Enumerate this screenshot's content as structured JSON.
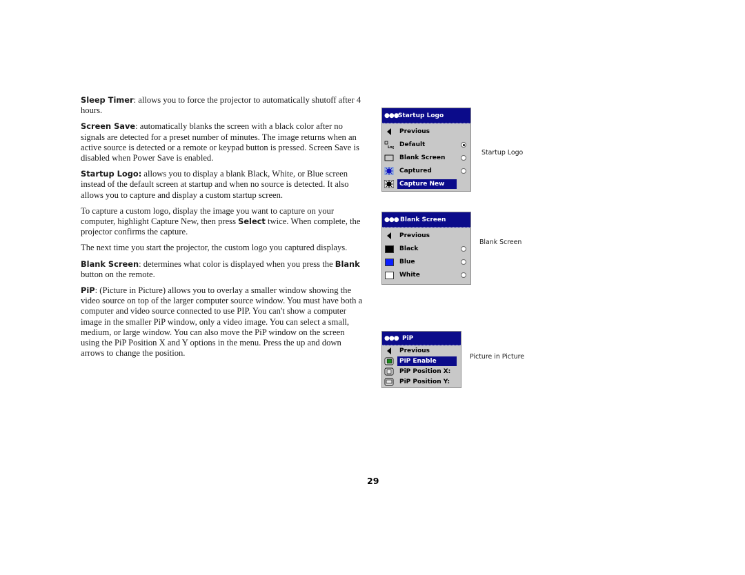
{
  "page_number": "29",
  "paragraphs": [
    {
      "bold": "Sleep Timer",
      "text": ": allows you to force the projector to automatically shutoff after 4 hours."
    },
    {
      "bold": "Screen Save",
      "text": ": automatically blanks the screen with a black color after no signals are detected for a preset number of minutes. The image returns when an active source is detected or a remote or keypad button is pressed. Screen Save is disabled when Power Save is enabled."
    },
    {
      "bold": "Startup Logo:",
      "text": " allows you to display a blank Black, White, or Blue screen instead of the default screen at startup and when no source is detected. It also allows you to capture and display a custom startup screen."
    },
    {
      "pre": "To capture a custom logo, display the image you want to capture on your computer, highlight Capture New, then press ",
      "bold": "Select",
      "text": " twice. When complete, the projector confirms the capture."
    },
    {
      "text": "The next time you start the projector, the custom logo you captured displays."
    },
    {
      "bold": "Blank Screen",
      "text": ": determines what color is displayed when you press the ",
      "bold2": "Blank",
      "text2": " button on the remote."
    },
    {
      "bold": "PiP",
      "text": ": (Picture in Picture) allows you to overlay a smaller window showing the video source on top of the larger computer source window. You must have both a computer and video source connected to use PIP. You can't show a computer image in the smaller PiP window, only a video image. You can select a small, medium, or large window. You can also move the PiP window on the screen using the PiP Position X and Y options in the menu. Press the up and down arrows to change the position."
    }
  ],
  "menus": {
    "startup_logo": {
      "title": "Startup Logo",
      "caption": "Startup Logo",
      "items": [
        {
          "label": "Previous",
          "icon": "back-arrow-icon"
        },
        {
          "label": "Default",
          "icon": "logo-icon",
          "radio": true,
          "selected": true
        },
        {
          "label": "Blank Screen",
          "icon": "blank-screen-icon",
          "radio": true,
          "selected": false
        },
        {
          "label": "Captured",
          "icon": "captured-icon",
          "radio": true,
          "selected": false
        },
        {
          "label": "Capture New",
          "icon": "capture-new-icon",
          "highlighted": true
        }
      ]
    },
    "blank_screen": {
      "title": "Blank Screen",
      "caption": "Blank Screen",
      "items": [
        {
          "label": "Previous",
          "icon": "back-arrow-icon"
        },
        {
          "label": "Black",
          "icon": "black-swatch-icon",
          "color": "#000000",
          "radio": true,
          "selected": false
        },
        {
          "label": "Blue",
          "icon": "blue-swatch-icon",
          "color": "#0a1eff",
          "radio": true,
          "selected": false
        },
        {
          "label": "White",
          "icon": "white-swatch-icon",
          "color": "#ffffff",
          "radio": true,
          "selected": false
        }
      ]
    },
    "pip": {
      "title": "PiP",
      "caption": "Picture in Picture",
      "items": [
        {
          "label": "Previous",
          "icon": "back-arrow-icon"
        },
        {
          "label": "PiP Enable",
          "icon": "pip-enable-icon",
          "highlighted": true
        },
        {
          "label": "PiP Position X:",
          "icon": "pip-position-x-icon"
        },
        {
          "label": "PiP Position Y:",
          "icon": "pip-position-y-icon"
        }
      ]
    }
  },
  "colors": {
    "menu_title_bg": "#0b0b8a",
    "menu_bg": "#c8c8c8"
  }
}
